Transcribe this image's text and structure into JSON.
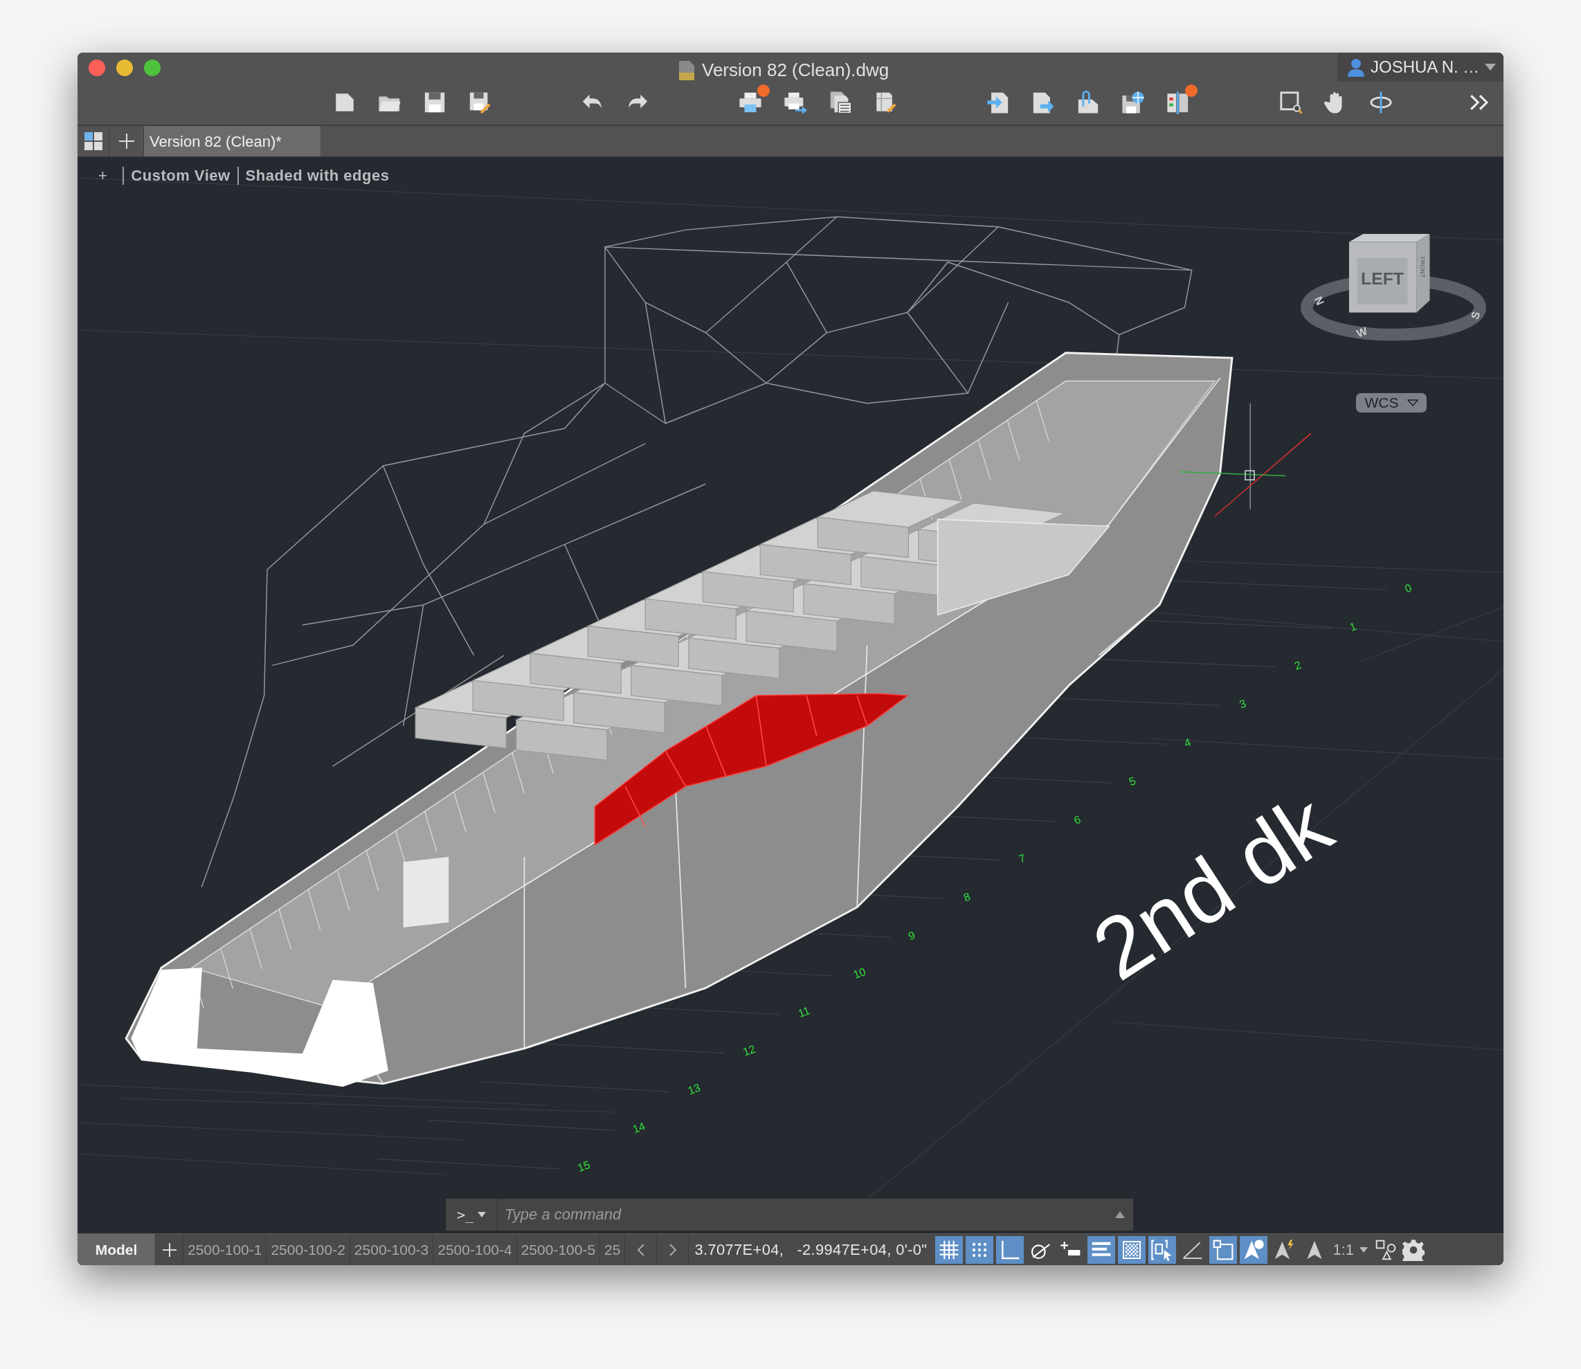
{
  "window": {
    "title": "Version 82 (Clean).dwg",
    "user": "JOSHUA N. …"
  },
  "toolbar": [
    {
      "items": [
        {
          "kind": "new",
          "badge": false
        },
        {
          "kind": "open",
          "badge": false
        },
        {
          "kind": "save",
          "badge": false
        },
        {
          "kind": "saveas",
          "badge": false
        }
      ]
    },
    {
      "items": [
        {
          "kind": "undo",
          "badge": false
        },
        {
          "kind": "redo",
          "badge": false
        }
      ]
    },
    {
      "items": [
        {
          "kind": "plot",
          "badge": true
        },
        {
          "kind": "publish",
          "badge": false
        },
        {
          "kind": "sheets",
          "badge": false
        },
        {
          "kind": "sheetedit",
          "badge": false
        }
      ]
    },
    {
      "items": [
        {
          "kind": "import",
          "badge": false
        },
        {
          "kind": "export",
          "badge": false
        },
        {
          "kind": "attach",
          "badge": false
        },
        {
          "kind": "saveweb",
          "badge": false
        },
        {
          "kind": "compare",
          "badge": true
        }
      ]
    },
    {
      "items": [
        {
          "kind": "zoomwindow",
          "badge": false
        },
        {
          "kind": "pan",
          "badge": false
        },
        {
          "kind": "orbit",
          "badge": false
        }
      ]
    },
    {
      "items": [
        {
          "kind": "more",
          "badge": false
        }
      ]
    }
  ],
  "document_tabs": [
    {
      "label": "Version 82 (Clean)*",
      "selected": true
    }
  ],
  "viewport": {
    "controls": [
      "+",
      "Custom View",
      "Shaded with edges"
    ],
    "viewcube": {
      "face": "LEFT",
      "side": "FRONT",
      "compass": [
        "N",
        "W",
        "S"
      ],
      "ucs": "WCS"
    },
    "station_labels": [
      "0",
      "1",
      "2",
      "3",
      "4",
      "5",
      "6",
      "7",
      "8",
      "9",
      "10",
      "11",
      "12",
      "13",
      "14",
      "15"
    ],
    "deck_label": "2nd dk"
  },
  "command_line": {
    "prompt": ">_",
    "placeholder": "Type a command"
  },
  "status_bar": {
    "tabs": [
      {
        "label": "Model",
        "selected": true
      },
      {
        "label": "2500-100-1",
        "selected": false
      },
      {
        "label": "2500-100-2",
        "selected": false
      },
      {
        "label": "2500-100-3",
        "selected": false
      },
      {
        "label": "2500-100-4",
        "selected": false
      },
      {
        "label": "2500-100-5",
        "selected": false
      },
      {
        "label": "25",
        "selected": false
      }
    ],
    "coordinates": "3.7077E+04,   -2.9947E+04, 0'-0\"",
    "toggles": [
      {
        "kind": "grid",
        "on": true
      },
      {
        "kind": "snap",
        "on": true
      },
      {
        "kind": "ortho",
        "on": true
      },
      {
        "kind": "polar",
        "on": false
      },
      {
        "kind": "dyninput",
        "on": false
      },
      {
        "kind": "lineweight",
        "on": true
      },
      {
        "kind": "transparency",
        "on": true
      },
      {
        "kind": "selcycle",
        "on": true
      },
      {
        "kind": "osnaptrack",
        "on": false
      },
      {
        "kind": "osnap",
        "on": true
      },
      {
        "kind": "annovis",
        "on": true
      },
      {
        "kind": "autoscale",
        "on": false
      },
      {
        "kind": "annoscale",
        "on": false
      }
    ],
    "annotation_scale": "1:1"
  }
}
